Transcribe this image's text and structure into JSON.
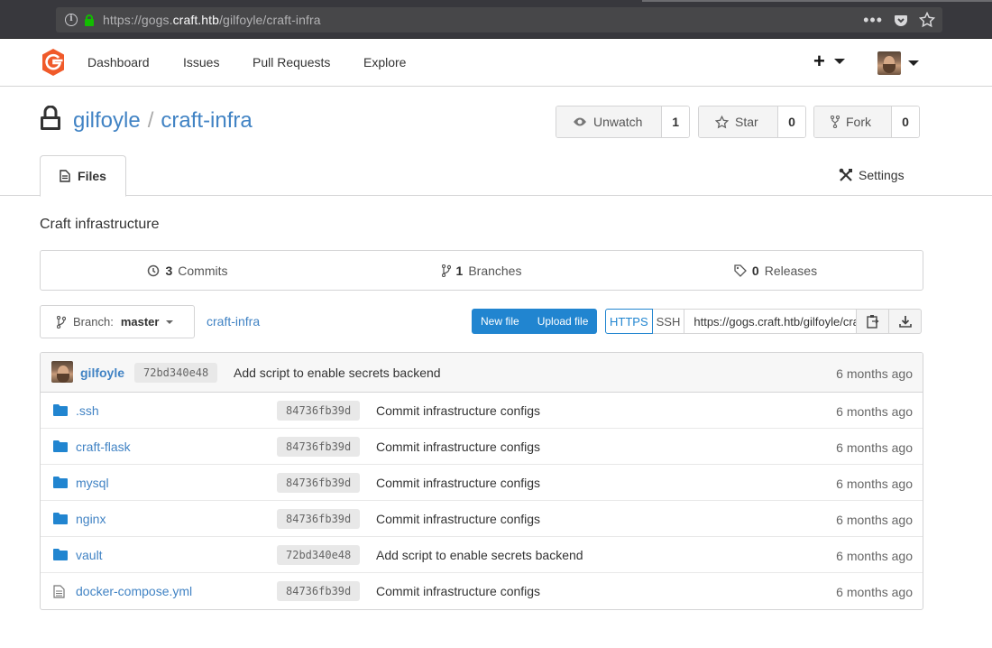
{
  "browser": {
    "url_scheme": "https://gogs.",
    "url_host": "craft.htb",
    "url_path": "/gilfoyle/craft-infra",
    "icons": [
      "info-icon",
      "lock-icon",
      "more-icon",
      "pocket-icon",
      "bookmark-star-icon"
    ]
  },
  "header": {
    "nav": [
      "Dashboard",
      "Issues",
      "Pull Requests",
      "Explore"
    ]
  },
  "repo": {
    "owner": "gilfoyle",
    "separator": "/",
    "name": "craft-infra",
    "watch_label": "Unwatch",
    "watch_count": "1",
    "star_label": "Star",
    "star_count": "0",
    "fork_label": "Fork",
    "fork_count": "0",
    "tab_files": "Files",
    "tab_settings": "Settings",
    "description": "Craft infrastructure"
  },
  "stats": {
    "commits_count": "3",
    "commits_label": "Commits",
    "branches_count": "1",
    "branches_label": "Branches",
    "releases_count": "0",
    "releases_label": "Releases"
  },
  "toolbar": {
    "branch_prefix": "Branch:",
    "branch_name": "master",
    "breadcrumb": "craft-infra",
    "new_file": "New file",
    "upload_file": "Upload file",
    "https": "HTTPS",
    "ssh": "SSH",
    "clone_url": "https://gogs.craft.htb/gilfoyle/craft-infra.git"
  },
  "latest_commit": {
    "author": "gilfoyle",
    "sha": "72bd340e48",
    "message": "Add script to enable secrets backend",
    "age": "6 months ago"
  },
  "files": [
    {
      "name": ".ssh",
      "type": "folder",
      "sha": "84736fb39d",
      "message": "Commit infrastructure configs",
      "age": "6 months ago"
    },
    {
      "name": "craft-flask",
      "type": "folder",
      "sha": "84736fb39d",
      "message": "Commit infrastructure configs",
      "age": "6 months ago"
    },
    {
      "name": "mysql",
      "type": "folder",
      "sha": "84736fb39d",
      "message": "Commit infrastructure configs",
      "age": "6 months ago"
    },
    {
      "name": "nginx",
      "type": "folder",
      "sha": "84736fb39d",
      "message": "Commit infrastructure configs",
      "age": "6 months ago"
    },
    {
      "name": "vault",
      "type": "folder",
      "sha": "72bd340e48",
      "message": "Add script to enable secrets backend",
      "age": "6 months ago"
    },
    {
      "name": "docker-compose.yml",
      "type": "file",
      "sha": "84736fb39d",
      "message": "Commit infrastructure configs",
      "age": "6 months ago"
    }
  ],
  "colors": {
    "link": "#4183c4",
    "primary_button": "#2185d0",
    "logo": "#f05a2a",
    "folder_icon": "#2185d0"
  }
}
